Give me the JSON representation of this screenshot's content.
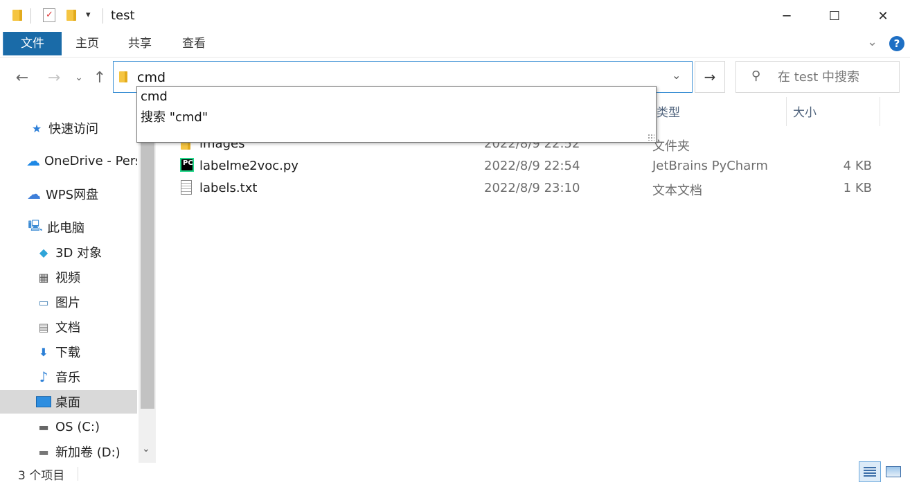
{
  "window": {
    "title": "test",
    "controls": {
      "minimize": "─",
      "maximize": "☐",
      "close": "✕"
    }
  },
  "ribbon": {
    "tabs": [
      {
        "label": "文件",
        "active": true
      },
      {
        "label": "主页",
        "active": false
      },
      {
        "label": "共享",
        "active": false
      },
      {
        "label": "查看",
        "active": false
      }
    ],
    "accent": "#1a6ba8"
  },
  "address": {
    "value": "cmd",
    "suggestions": [
      "cmd",
      "搜索 \"cmd\""
    ]
  },
  "search": {
    "placeholder": "在 test 中搜索"
  },
  "sidebar": {
    "items": [
      {
        "label": "快速访问",
        "icon": "star-icon"
      },
      {
        "label": "OneDrive - Personal",
        "icon": "onedrive-cloud-icon"
      },
      {
        "label": "WPS网盘",
        "icon": "wps-cloud-icon"
      },
      {
        "label": "此电脑",
        "icon": "computer-icon"
      },
      {
        "label": "3D 对象",
        "icon": "3d-objects-icon"
      },
      {
        "label": "视频",
        "icon": "video-icon"
      },
      {
        "label": "图片",
        "icon": "pictures-icon"
      },
      {
        "label": "文档",
        "icon": "documents-icon"
      },
      {
        "label": "下载",
        "icon": "download-icon"
      },
      {
        "label": "音乐",
        "icon": "music-icon"
      },
      {
        "label": "桌面",
        "icon": "desktop-icon",
        "selected": true
      },
      {
        "label": "OS (C:)",
        "icon": "drive-c-icon"
      },
      {
        "label": "新加卷 (D:)",
        "icon": "drive-d-icon"
      }
    ]
  },
  "files": {
    "columns": {
      "type": "类型",
      "size": "大小"
    },
    "rows": [
      {
        "name": "images",
        "date": "2022/8/9 22:52",
        "type": "文件夹",
        "size": "",
        "icon": "folder-icon"
      },
      {
        "name": "labelme2voc.py",
        "date": "2022/8/9 22:54",
        "type": "JetBrains PyCharm",
        "size": "4 KB",
        "icon": "pycharm-file-icon"
      },
      {
        "name": "labels.txt",
        "date": "2022/8/9 23:10",
        "type": "文本文档",
        "size": "1 KB",
        "icon": "text-file-icon"
      }
    ]
  },
  "status": {
    "item_count": "3 个项目"
  }
}
